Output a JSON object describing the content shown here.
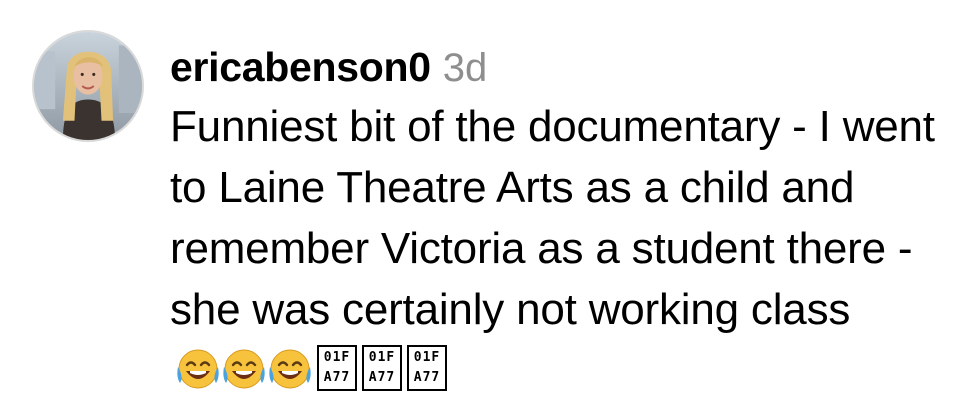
{
  "comment": {
    "username": "ericabenson0",
    "time": "3d",
    "text": "Funniest bit of the documentary - I went to Laine Theatre Arts as a child and remember Victoria as a student there - she was certainly not working class",
    "emojis": [
      "face-with-tears-of-joy-icon",
      "face-with-tears-of-joy-icon",
      "face-with-tears-of-joy-icon"
    ],
    "missing_glyphs": [
      {
        "top": "01F",
        "bottom": "A77"
      },
      {
        "top": "01F",
        "bottom": "A77"
      },
      {
        "top": "01F",
        "bottom": "A77"
      }
    ]
  },
  "colors": {
    "text": "#000000",
    "timestamp": "#8e8e8e",
    "emoji_face": "#f7c23c",
    "emoji_tears": "#4aa3df"
  }
}
